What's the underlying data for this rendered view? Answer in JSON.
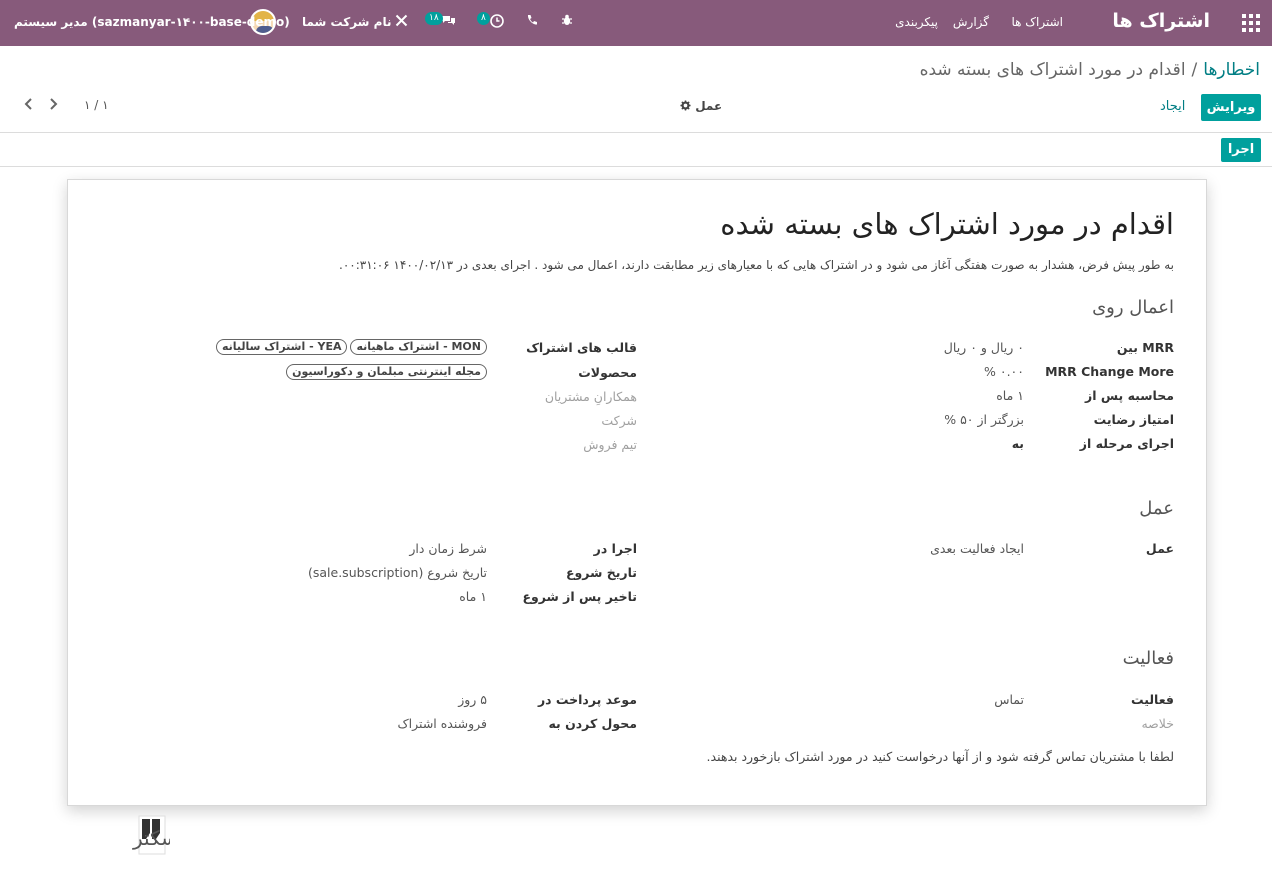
{
  "navbar": {
    "app_title": "اشتراک ها",
    "menu": [
      "اشتراک ها",
      "گزارش",
      "پیکربندی"
    ],
    "company": "نام شرکت شما",
    "user": "مدیر سیستم (sazmanyar-۱۴۰۰-base-demo)",
    "messages_badge": "۱۸",
    "activities_badge": "۸",
    "icons": [
      "apps-grid-icon",
      "bug-icon",
      "phone-icon",
      "clock-icon",
      "chat-icon",
      "tools-icon"
    ]
  },
  "control": {
    "breadcrumb_parent": "اخطارها",
    "breadcrumb_sep": "/",
    "breadcrumb_current": "اقدام در مورد اشتراک های بسته شده",
    "edit_label": "ویرایش",
    "create_label": "ایجاد",
    "action_label": "عمل",
    "pager": "۱ / ۱",
    "run_label": "اجرا"
  },
  "sheet": {
    "title": "اقدام در مورد اشتراک های بسته شده",
    "description": "به طور پیش فرض، هشدار به صورت هفتگی آغاز می شود و در اشتراک هایی که با معیارهای زیر مطابقت دارند، اعمال می شود . اجرای بعدی در ۱۴۰۰/۰۲/۱۳ ۰۰:۳۱:۰۶.",
    "apply_on": {
      "heading": "اعمال روی",
      "right": [
        {
          "label": "MRR بین",
          "value": "۰ ریال و ۰ ریال"
        },
        {
          "label": "MRR Change More",
          "value": "۰.۰۰ %"
        },
        {
          "label": "محاسبه پس از",
          "value": "۱ ماه"
        },
        {
          "label": "امتیاز رضایت",
          "value": "بزرگتر از ۵۰ %"
        },
        {
          "label": "اجرای مرحله از",
          "value": "به"
        }
      ],
      "left": [
        {
          "label": "قالب های اشتراک",
          "tags": [
            "MON - اشتراک ماهیانه",
            "YEA - اشتراک سالیانه"
          ]
        },
        {
          "label": "محصولات",
          "tags": [
            "مجله اینترنتی مبلمان و دکوراسیون"
          ]
        },
        {
          "label": "همکارانِ مشتریان"
        },
        {
          "label": "شرکت"
        },
        {
          "label": "تیم فروش"
        }
      ]
    },
    "action": {
      "heading": "عمل",
      "right": [
        {
          "label": "عمل",
          "value": "ایجاد فعالیت بعدی"
        }
      ],
      "left": [
        {
          "label": "اجرا در",
          "value": "شرط زمان دار"
        },
        {
          "label": "تاریخ شروع",
          "value": "تاریخ شروع (sale.subscription)"
        },
        {
          "label": "تاخیر پس از شروع",
          "value": "۱ ماه"
        }
      ]
    },
    "activity": {
      "heading": "فعالیت",
      "right": [
        {
          "label": "فعالیت",
          "value": "تماس"
        },
        {
          "label": "خلاصه"
        }
      ],
      "left": [
        {
          "label": "موعد پرداخت در",
          "value": "۵ روز"
        },
        {
          "label": "محول کردن به",
          "value": "فروشنده اشتراک"
        }
      ],
      "note": "لطفا با مشتریان تماس گرفته شود و از آنها درخواست کنید در مورد اشتراک بازخورد بدهند."
    }
  },
  "watermark": {
    "text": "تیسکتر"
  }
}
